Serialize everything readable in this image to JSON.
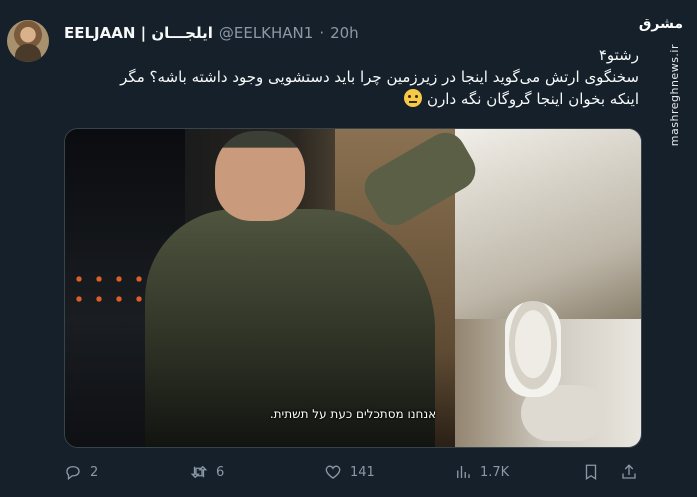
{
  "tweet": {
    "display_name": "EELJAAN | ایلجـــان",
    "handle": "@EELKHAN1",
    "separator": "·",
    "time": "20h",
    "text_line1": "رشتو۴",
    "text_line2": "سخنگوی ارتش می‌گوید اینجا در زیرزمین چرا باید دستشویی وجود داشته باشه؟ مگر",
    "text_line3": "اینکه بخوان اینجا گروگان نگه دارن",
    "emoji": "slightly-smiling-face",
    "video_subtitle": "אנחנו מסתכלים כעת על תשתית.",
    "replies": "2",
    "retweets": "6",
    "likes": "141",
    "views": "1.7K"
  },
  "watermark": {
    "logo": "مشرق",
    "site": "mashreghnews.ir"
  },
  "colors": {
    "background": "#15202b",
    "text": "#f7f9f9",
    "secondary": "#8b98a5",
    "border": "#38444d"
  }
}
